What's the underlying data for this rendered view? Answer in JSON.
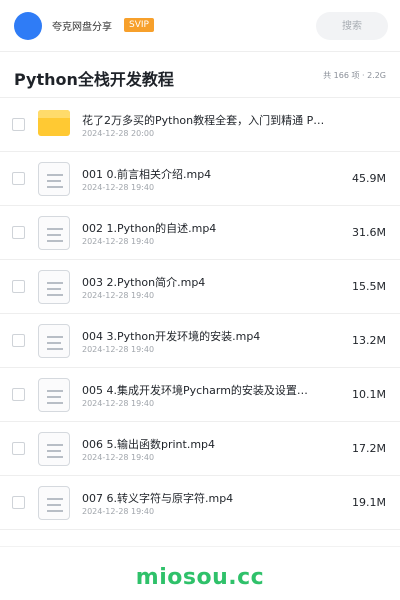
{
  "header": {
    "app_name": "夸克网盘分享",
    "badge": "SVIP",
    "search_placeholder": "搜索",
    "avatar_color": "#2f7cf6",
    "badge_color": "#f7a02b"
  },
  "folder": {
    "title": "Python全栈开发教程",
    "summary": "共 166 项 · 2.2G"
  },
  "files": [
    {
      "icon": "folder-icon",
      "name": "花了2万多买的Python教程全套，入门到精通 P…",
      "date": "2024-12-28 20:00",
      "size": ""
    },
    {
      "icon": "video-file-icon",
      "name": "001 0.前言相关介绍.mp4",
      "date": "2024-12-28 19:40",
      "size": "45.9M"
    },
    {
      "icon": "video-file-icon",
      "name": "002 1.Python的自述.mp4",
      "date": "2024-12-28 19:40",
      "size": "31.6M"
    },
    {
      "icon": "video-file-icon",
      "name": "003 2.Python简介.mp4",
      "date": "2024-12-28 19:40",
      "size": "15.5M"
    },
    {
      "icon": "video-file-icon",
      "name": "004 3.Python开发环境的安装.mp4",
      "date": "2024-12-28 19:40",
      "size": "13.2M"
    },
    {
      "icon": "video-file-icon",
      "name": "005 4.集成开发环境Pycharm的安装及设置…",
      "date": "2024-12-28 19:40",
      "size": "10.1M"
    },
    {
      "icon": "video-file-icon",
      "name": "006 5.输出函数print.mp4",
      "date": "2024-12-28 19:40",
      "size": "17.2M"
    },
    {
      "icon": "video-file-icon",
      "name": "007 6.转义字符与原字符.mp4",
      "date": "2024-12-28 19:40",
      "size": "19.1M"
    }
  ],
  "footer": {
    "watermark": "miosou.cc",
    "watermark_color": "#2fc16a"
  }
}
